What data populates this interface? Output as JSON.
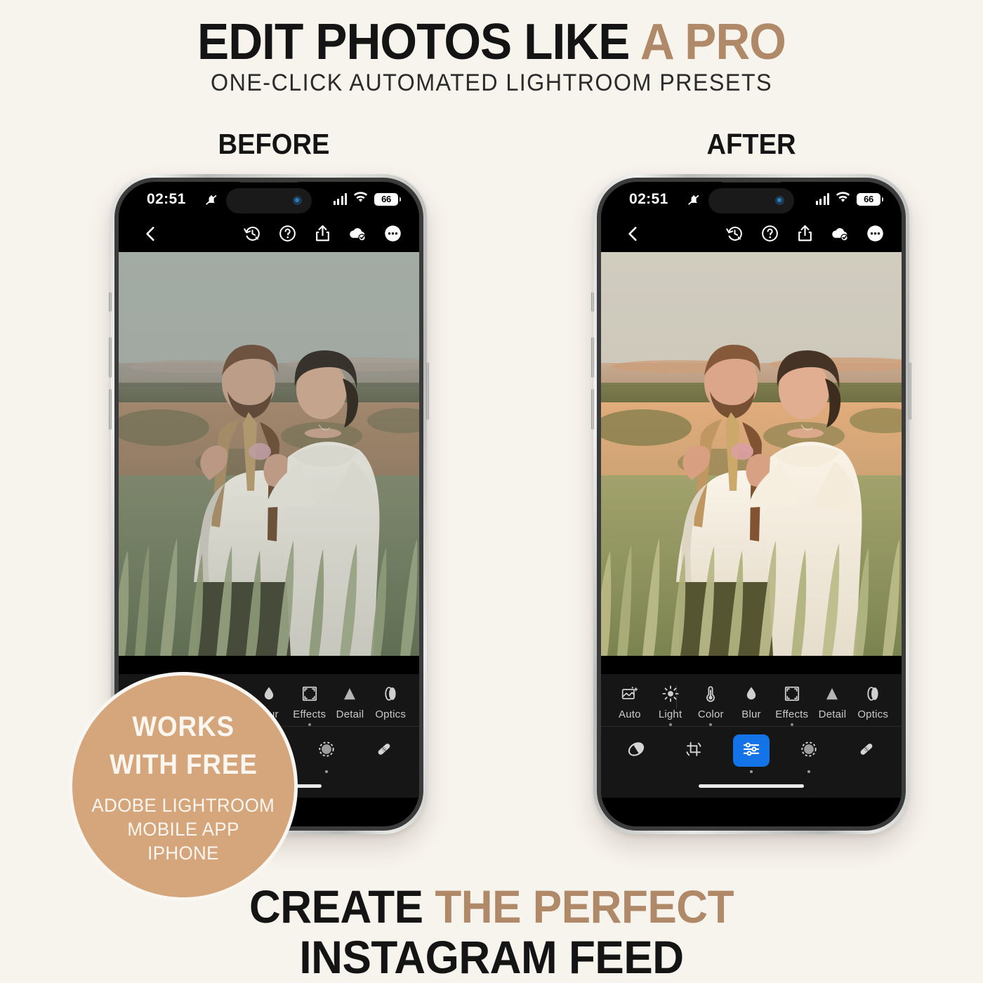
{
  "colors": {
    "background": "#F7F3ED",
    "accent_tan": "#B08968",
    "badge_fill": "#D5A57B",
    "badge_border": "#FAF7F2",
    "text_dark": "#141414",
    "lr_active_blue": "#1473E6"
  },
  "header": {
    "title_part1": "EDIT PHOTOS LIKE ",
    "title_accent": "A PRO",
    "subtitle": "ONE-CLICK AUTOMATED LIGHTROOM PRESETS"
  },
  "comparison": {
    "before_label": "BEFORE",
    "after_label": "AFTER"
  },
  "phone": {
    "status_bar": {
      "time": "02:51",
      "mute_icon": "bell-slash-icon",
      "signal_icon": "cellular-bars-icon",
      "wifi_icon": "wifi-icon",
      "battery_percent": "66"
    },
    "lightroom_top_bar": {
      "back_icon": "chevron-left-icon",
      "icons": [
        {
          "name": "version-history-icon",
          "label": "Versions"
        },
        {
          "name": "help-circle-icon",
          "label": "Help"
        },
        {
          "name": "share-upload-icon",
          "label": "Share"
        },
        {
          "name": "cloud-synced-icon",
          "label": "Cloud Synced"
        },
        {
          "name": "more-options-icon",
          "label": "More"
        }
      ]
    },
    "edit_tools": [
      {
        "icon": "auto-magic-icon",
        "label": "Auto",
        "has_dot": false
      },
      {
        "icon": "sun-icon",
        "label": "Light",
        "has_dot": true
      },
      {
        "icon": "thermometer-icon",
        "label": "Color",
        "has_dot": true
      },
      {
        "icon": "droplet-icon",
        "label": "Blur",
        "has_dot": false
      },
      {
        "icon": "frame-corners-icon",
        "label": "Effects",
        "has_dot": true
      },
      {
        "icon": "triangle-icon",
        "label": "Detail",
        "has_dot": false
      },
      {
        "icon": "lens-icon",
        "label": "Optics",
        "has_dot": false
      }
    ],
    "mode_bar": [
      {
        "icon": "presets-icon",
        "label": "Presets",
        "active": false,
        "has_dot": false
      },
      {
        "icon": "crop-icon",
        "label": "Crop",
        "active": false,
        "has_dot": false
      },
      {
        "icon": "sliders-icon",
        "label": "Edit",
        "active": true,
        "has_dot": true
      },
      {
        "icon": "masking-icon",
        "label": "Masking",
        "active": false,
        "has_dot": true
      },
      {
        "icon": "healing-icon",
        "label": "Healing",
        "active": false,
        "has_dot": false
      }
    ]
  },
  "badge": {
    "line1": "WORKS",
    "line2": "WITH FREE",
    "line3": "ADOBE LIGHTROOM",
    "line4": "MOBILE APP",
    "line5": "IPHONE"
  },
  "footer": {
    "line1_part1": "CREATE ",
    "line1_accent": "THE PERFECT",
    "line2": "INSTAGRAM FEED"
  }
}
